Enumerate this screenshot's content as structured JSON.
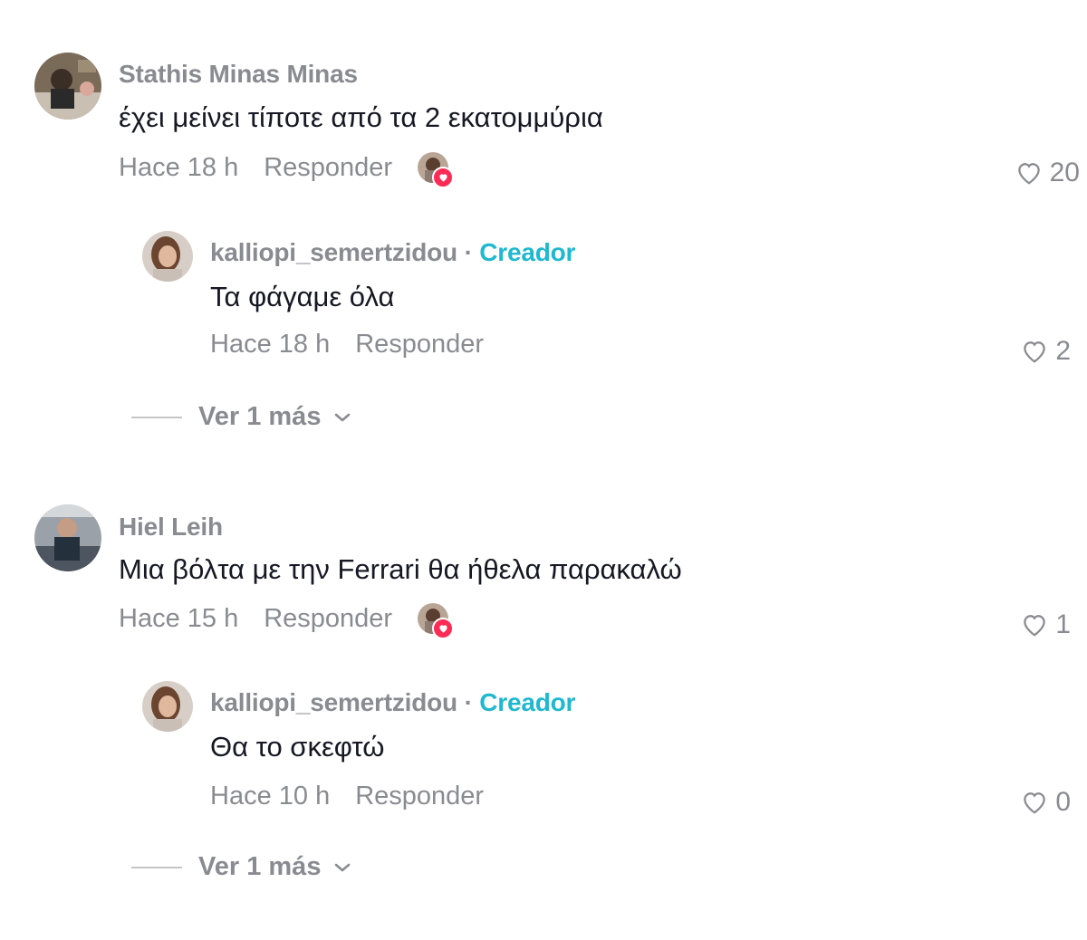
{
  "comments": [
    {
      "author": "Stathis Minas Minas",
      "text": "έχει μείνει τίποτε από τα 2 εκατομμύρια",
      "time": "Hace 18 h",
      "reply_label": "Responder",
      "likes": "20",
      "liked_by_creator": true,
      "reply": {
        "author": "kalliopi_semertzidou",
        "separator": "·",
        "badge": "Creador",
        "text": "Τα φάγαμε όλα",
        "time": "Hace 18 h",
        "reply_label": "Responder",
        "likes": "2"
      },
      "view_more": "Ver 1 más"
    },
    {
      "author": "Hiel Leih",
      "text": "Μια βόλτα με την Ferrari θα ήθελα παρακαλώ",
      "time": "Hace 15 h",
      "reply_label": "Responder",
      "likes": "1",
      "liked_by_creator": true,
      "reply": {
        "author": "kalliopi_semertzidou",
        "separator": "·",
        "badge": "Creador",
        "text": "Θα το σκεφτώ",
        "time": "Hace 10 h",
        "reply_label": "Responder",
        "likes": "0"
      },
      "view_more": "Ver 1 más"
    }
  ],
  "icons": {
    "like": "heart-outline-icon",
    "creator_liked": "heart-badge-icon",
    "expand": "chevron-down-icon"
  },
  "colors": {
    "accent_creator": "#20b8cf",
    "like_badge": "#fe2c55",
    "muted_text": "#8a8b91",
    "body_text": "#161823"
  }
}
